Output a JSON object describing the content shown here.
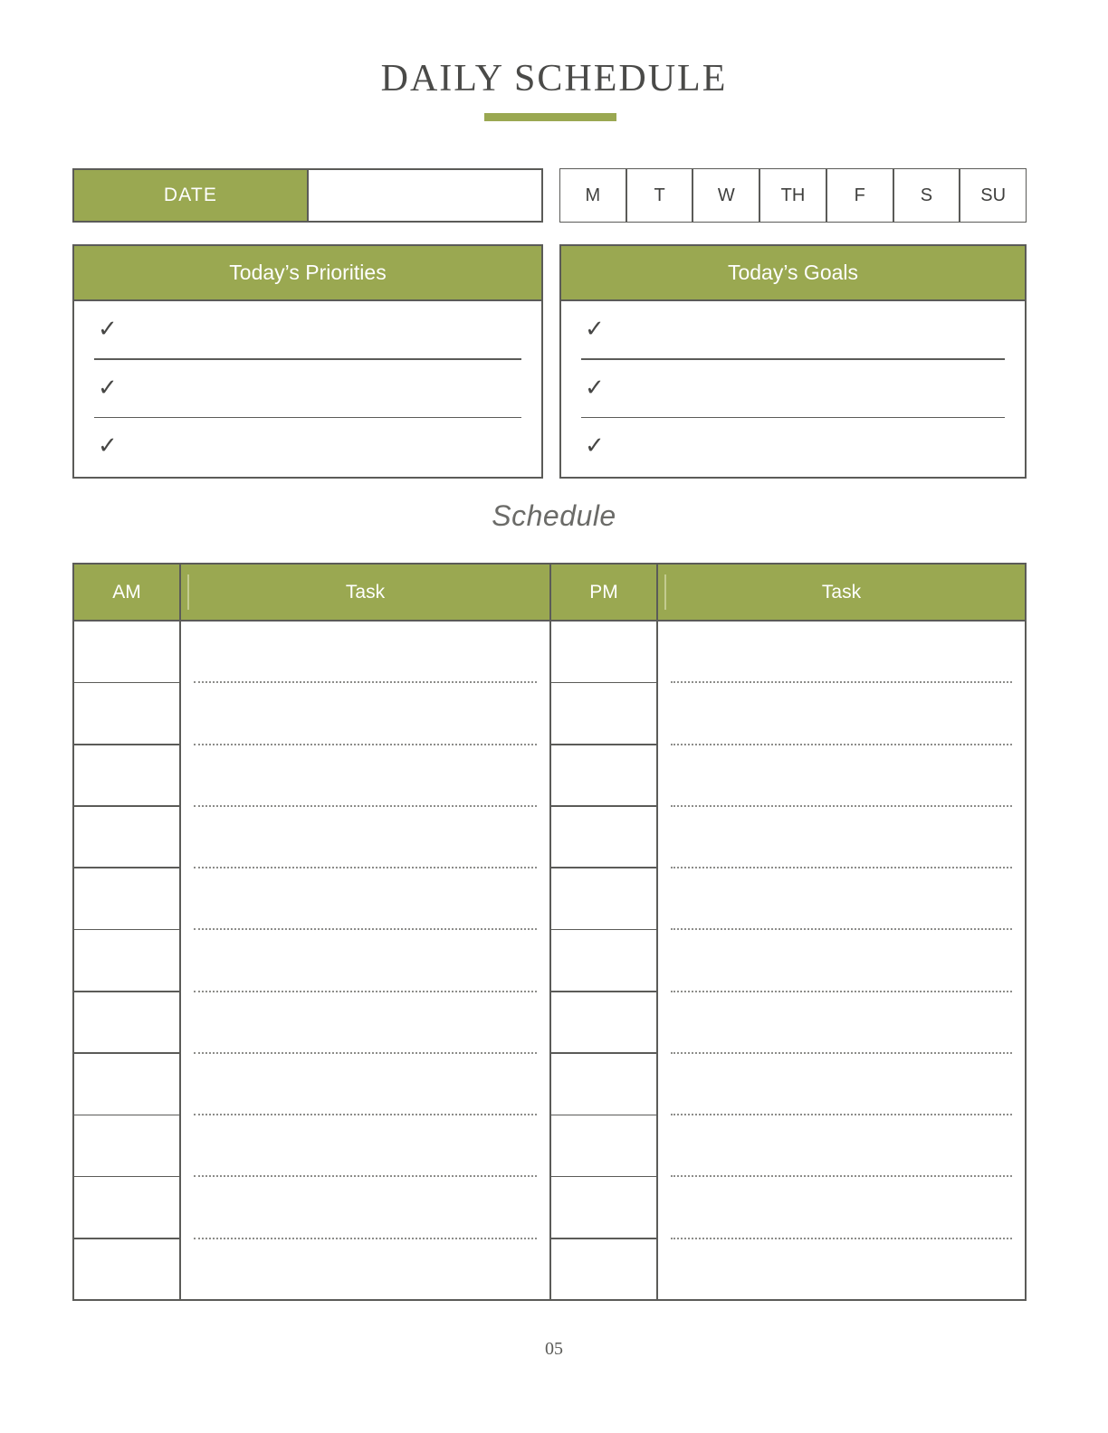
{
  "document": {
    "title": "DAILY SCHEDULE",
    "page_number": "05",
    "accent_color": "#9aa851",
    "border_color": "#5b5b58",
    "text_color": "#4a4a48"
  },
  "date_row": {
    "label": "DATE",
    "value": "",
    "placeholder": ""
  },
  "days": [
    {
      "label": "M",
      "name": "monday"
    },
    {
      "label": "T",
      "name": "tuesday"
    },
    {
      "label": "W",
      "name": "wednesday"
    },
    {
      "label": "TH",
      "name": "thursday"
    },
    {
      "label": "F",
      "name": "friday"
    },
    {
      "label": "S",
      "name": "saturday"
    },
    {
      "label": "SU",
      "name": "sunday"
    }
  ],
  "priorities": {
    "title": "Today’s Priorities",
    "check_glyph": "✓",
    "items": [
      {
        "glyph": "✓",
        "text": ""
      },
      {
        "glyph": "✓",
        "text": ""
      },
      {
        "glyph": "✓",
        "text": ""
      }
    ]
  },
  "goals": {
    "title": "Today’s Goals",
    "check_glyph": "✓",
    "items": [
      {
        "glyph": "✓",
        "text": ""
      },
      {
        "glyph": "✓",
        "text": ""
      },
      {
        "glyph": "✓",
        "text": ""
      }
    ]
  },
  "schedule": {
    "heading": "Schedule",
    "columns": [
      {
        "label": "AM",
        "name": "am-hour"
      },
      {
        "label": "Task",
        "name": "am-task"
      },
      {
        "label": "PM",
        "name": "pm-hour"
      },
      {
        "label": "Task",
        "name": "pm-task"
      }
    ],
    "row_count": 11,
    "am_hours": [
      "",
      "",
      "",
      "",
      "",
      "",
      "",
      "",
      "",
      "",
      ""
    ],
    "am_tasks": [
      "",
      "",
      "",
      "",
      "",
      "",
      "",
      "",
      "",
      "",
      ""
    ],
    "pm_hours": [
      "",
      "",
      "",
      "",
      "",
      "",
      "",
      "",
      "",
      "",
      ""
    ],
    "pm_tasks": [
      "",
      "",
      "",
      "",
      "",
      "",
      "",
      "",
      "",
      "",
      ""
    ]
  }
}
